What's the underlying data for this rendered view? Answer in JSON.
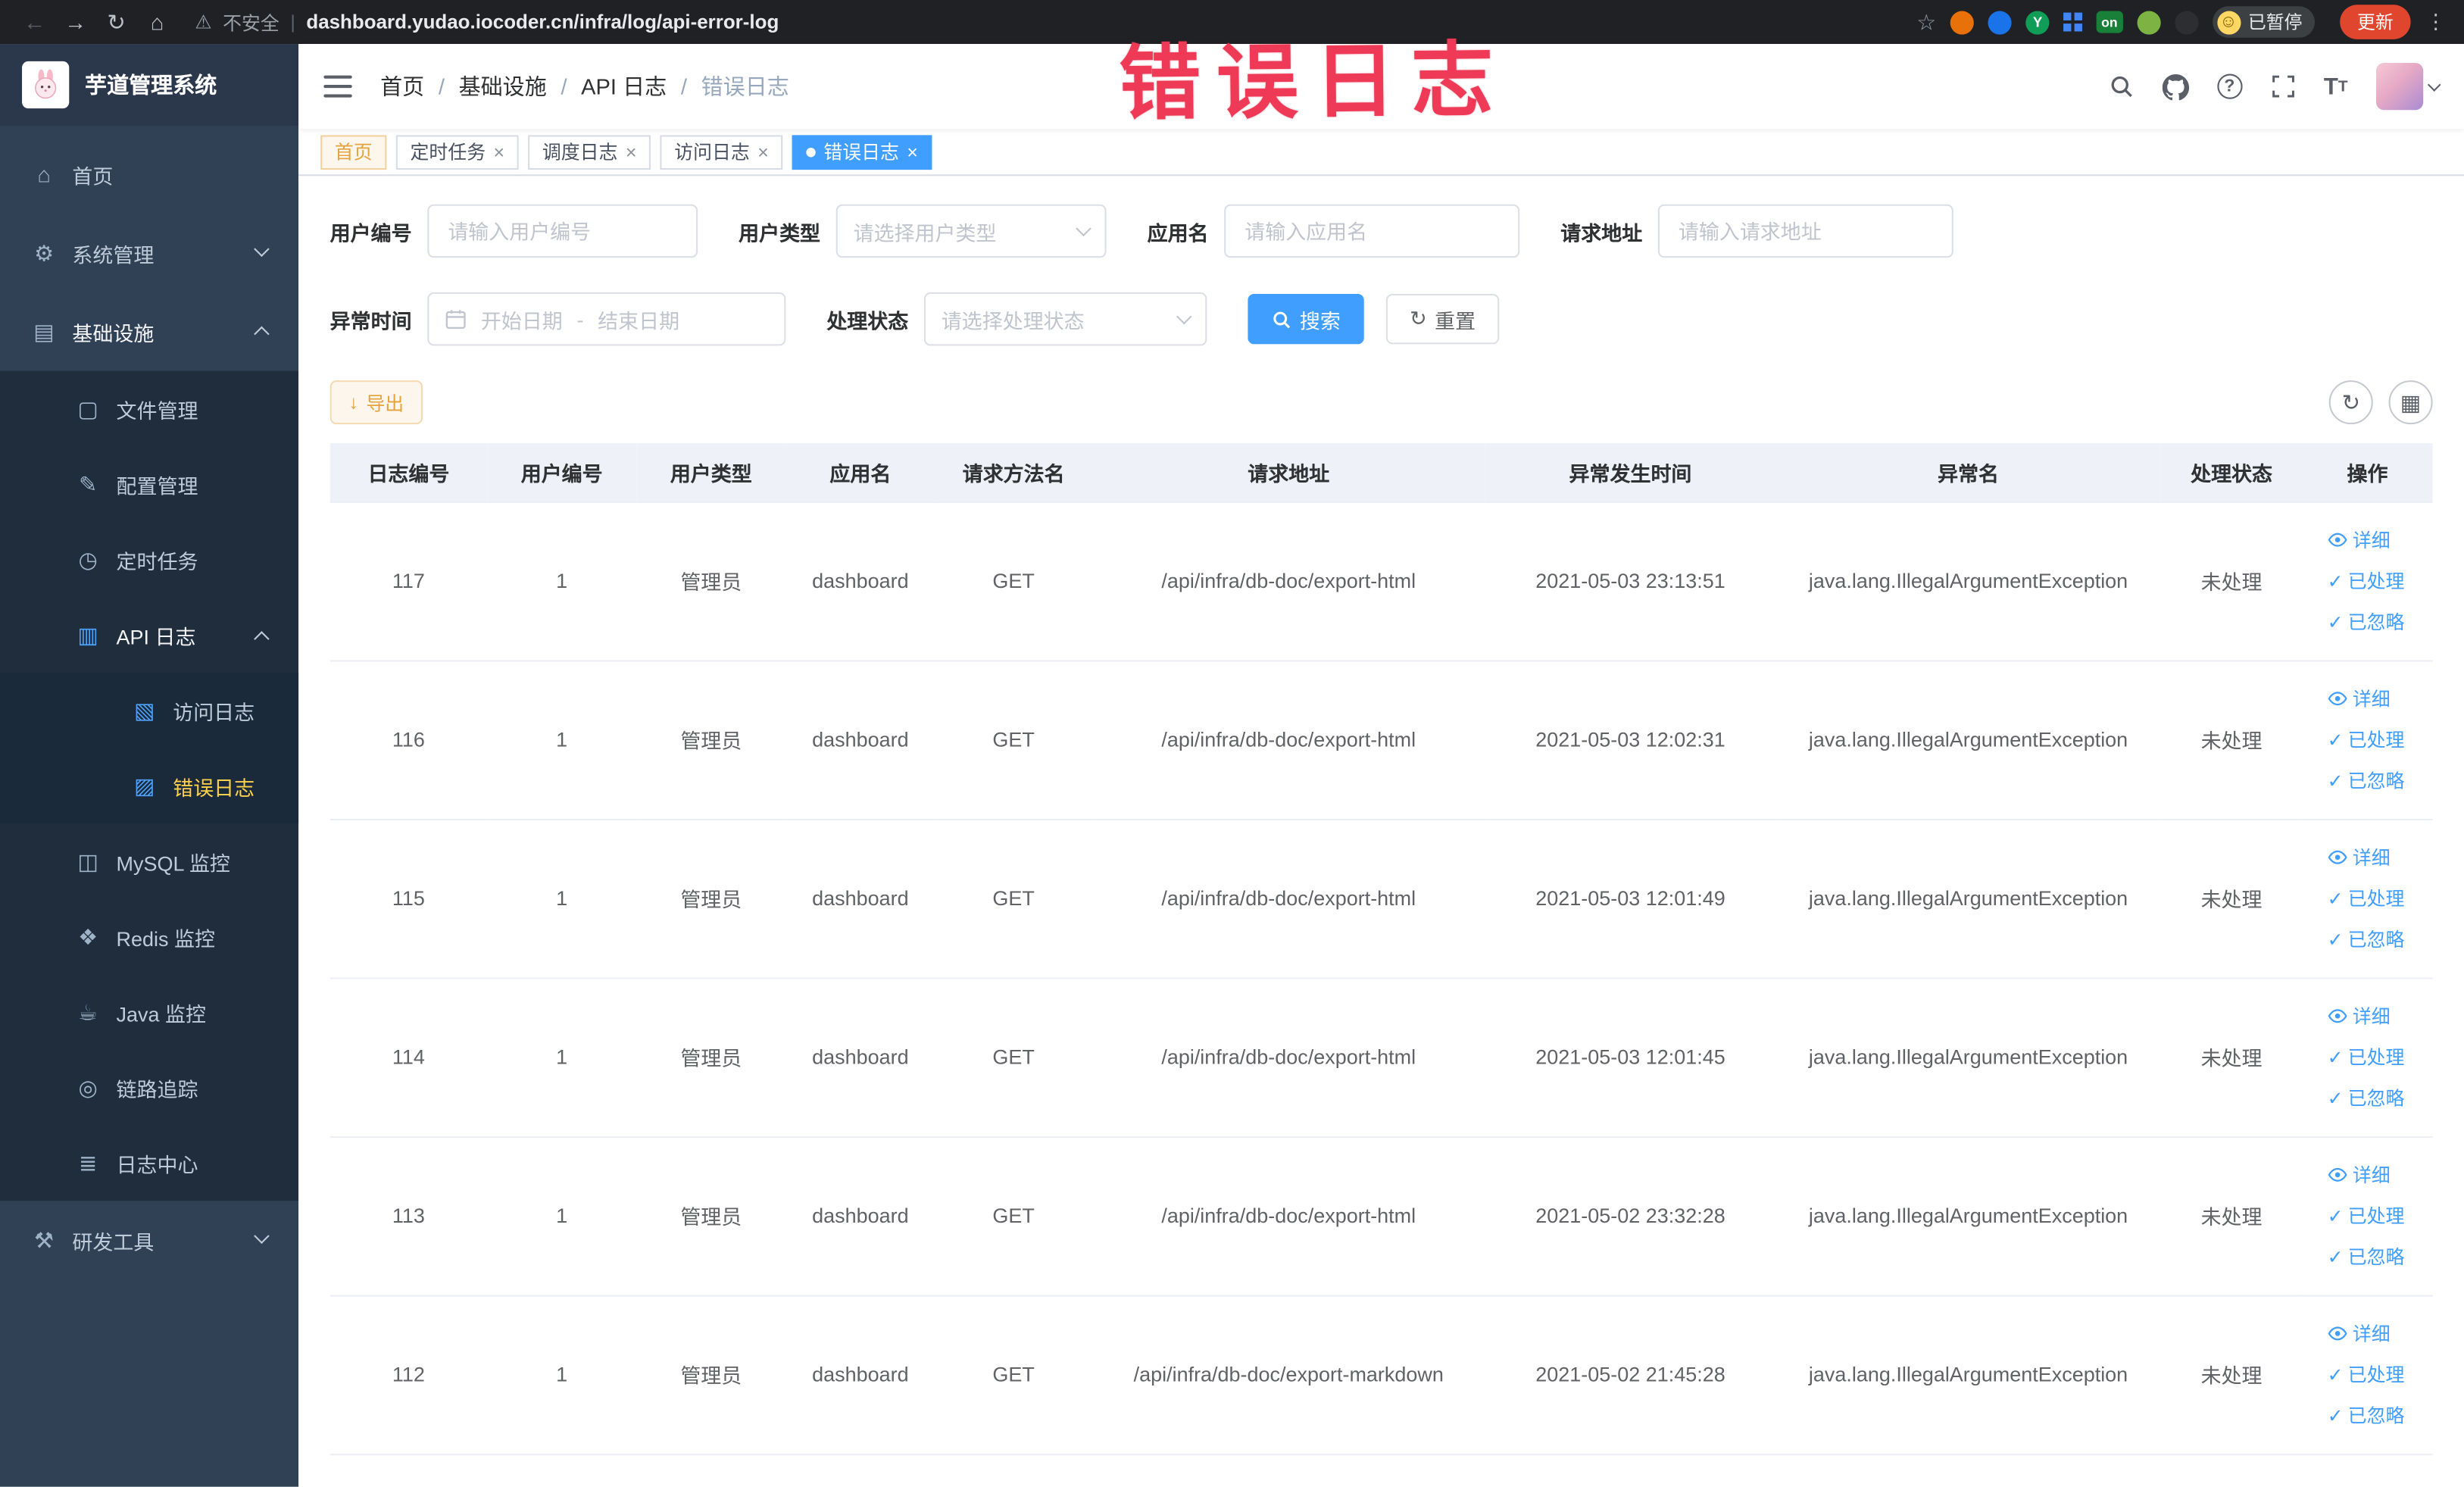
{
  "browser": {
    "security": "不安全",
    "url": "dashboard.yudao.iocoder.cn/infra/log/api-error-log",
    "ext_y": "Y",
    "ext_on": "on",
    "profile_badge": "已暂停",
    "update": "更新"
  },
  "annotation": "错误日志",
  "ui": {
    "back": "←",
    "forward": "→",
    "reload": "↻",
    "home": "⌂",
    "warning": "⚠",
    "divider": "|",
    "star": "☆",
    "smile": "☺",
    "ellipsis": "⋮",
    "close": "×",
    "check": "✓",
    "refresh": "↻",
    "grid": "▦",
    "export_arrow": "↓",
    "help": "?",
    "fontsize_big": "T",
    "fontsize_small": "T"
  },
  "sidebar": {
    "title": "芋道管理系统",
    "items": [
      {
        "label": "首页",
        "glyph": "⌂"
      },
      {
        "label": "系统管理",
        "glyph": "⚙"
      },
      {
        "label": "基础设施",
        "glyph": "▤"
      },
      {
        "label": "文件管理",
        "glyph": "▢"
      },
      {
        "label": "配置管理",
        "glyph": "✎"
      },
      {
        "label": "定时任务",
        "glyph": "◷"
      },
      {
        "label": "API 日志",
        "glyph": "▥"
      },
      {
        "label": "访问日志",
        "glyph": "▧"
      },
      {
        "label": "错误日志",
        "glyph": "▨"
      },
      {
        "label": "MySQL 监控",
        "glyph": "◫"
      },
      {
        "label": "Redis 监控",
        "glyph": "❖"
      },
      {
        "label": "Java 监控",
        "glyph": "☕"
      },
      {
        "label": "链路追踪",
        "glyph": "◎"
      },
      {
        "label": "日志中心",
        "glyph": "≣"
      },
      {
        "label": "研发工具",
        "glyph": "⚒"
      }
    ]
  },
  "breadcrumb": [
    "首页",
    "基础设施",
    "API 日志",
    "错误日志"
  ],
  "tabs": [
    {
      "label": "首页"
    },
    {
      "label": "定时任务"
    },
    {
      "label": "调度日志"
    },
    {
      "label": "访问日志"
    },
    {
      "label": "错误日志"
    }
  ],
  "filters": {
    "user_id_label": "用户编号",
    "user_id_placeholder": "请输入用户编号",
    "user_type_label": "用户类型",
    "user_type_placeholder": "请选择用户类型",
    "app_label": "应用名",
    "app_placeholder": "请输入应用名",
    "url_label": "请求地址",
    "url_placeholder": "请输入请求地址",
    "time_label": "异常时间",
    "time_start_placeholder": "开始日期",
    "time_separator": "-",
    "time_end_placeholder": "结束日期",
    "status_label": "处理状态",
    "status_placeholder": "请选择处理状态",
    "search": "搜索",
    "reset": "重置"
  },
  "toolbar": {
    "export": "导出"
  },
  "table": {
    "columns": [
      "日志编号",
      "用户编号",
      "用户类型",
      "应用名",
      "请求方法名",
      "请求地址",
      "异常发生时间",
      "异常名",
      "处理状态",
      "操作"
    ],
    "actions": {
      "detail": "详细",
      "process": "已处理",
      "ignore": "已忽略"
    },
    "rows": [
      {
        "id": "117",
        "user_id": "1",
        "user_type": "管理员",
        "app": "dashboard",
        "method": "GET",
        "url": "/api/infra/db-doc/export-html",
        "time": "2021-05-03 23:13:51",
        "exception": "java.lang.IllegalArgumentException",
        "status": "未处理"
      },
      {
        "id": "116",
        "user_id": "1",
        "user_type": "管理员",
        "app": "dashboard",
        "method": "GET",
        "url": "/api/infra/db-doc/export-html",
        "time": "2021-05-03 12:02:31",
        "exception": "java.lang.IllegalArgumentException",
        "status": "未处理"
      },
      {
        "id": "115",
        "user_id": "1",
        "user_type": "管理员",
        "app": "dashboard",
        "method": "GET",
        "url": "/api/infra/db-doc/export-html",
        "time": "2021-05-03 12:01:49",
        "exception": "java.lang.IllegalArgumentException",
        "status": "未处理"
      },
      {
        "id": "114",
        "user_id": "1",
        "user_type": "管理员",
        "app": "dashboard",
        "method": "GET",
        "url": "/api/infra/db-doc/export-html",
        "time": "2021-05-03 12:01:45",
        "exception": "java.lang.IllegalArgumentException",
        "status": "未处理"
      },
      {
        "id": "113",
        "user_id": "1",
        "user_type": "管理员",
        "app": "dashboard",
        "method": "GET",
        "url": "/api/infra/db-doc/export-html",
        "time": "2021-05-02 23:32:28",
        "exception": "java.lang.IllegalArgumentException",
        "status": "未处理"
      },
      {
        "id": "112",
        "user_id": "1",
        "user_type": "管理员",
        "app": "dashboard",
        "method": "GET",
        "url": "/api/infra/db-doc/export-markdown",
        "time": "2021-05-02 21:45:28",
        "exception": "java.lang.IllegalArgumentException",
        "status": "未处理"
      }
    ]
  }
}
